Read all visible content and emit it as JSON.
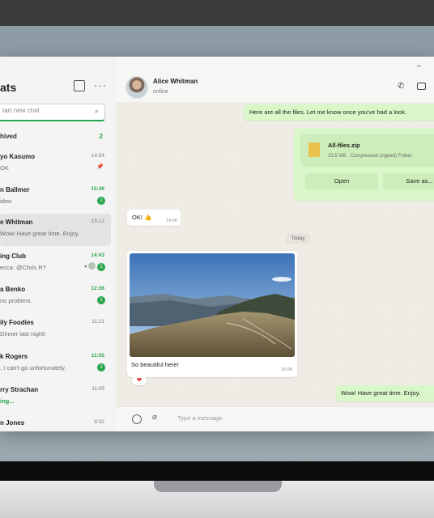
{
  "sidebar": {
    "title": "ats",
    "search_placeholder": "tart new chat",
    "archived_label": "hived",
    "archived_count": "2",
    "chats": [
      {
        "name": "yo Kasumo",
        "preview": "OK",
        "time": "14:54",
        "pinned": true
      },
      {
        "name": "n Ballmer",
        "preview": "ideo",
        "time": "15:36",
        "unread": "1"
      },
      {
        "name": "e Whitman",
        "preview": "Wow! Have great time. Enjoy.",
        "time": "15:12"
      },
      {
        "name": "ing Club",
        "preview": "ecca: @Chris R?",
        "time": "14:43",
        "unread": "1"
      },
      {
        "name": "a Benko",
        "preview": "no problem.",
        "time": "12:36",
        "unread": "1"
      },
      {
        "name": "ily Foodies",
        "preview": "Dinner last night!",
        "time": "11:21"
      },
      {
        "name": "k Rogers",
        "preview": ", I can't go unfortunately.",
        "time": "11:05",
        "unread": "1"
      },
      {
        "name": "rry Strachan",
        "preview": "ing...",
        "time": "11:05"
      },
      {
        "name": "n Jones",
        "preview": "",
        "time": "8:32"
      }
    ]
  },
  "chat": {
    "contact_name": "Alice Whitman",
    "contact_status": "online",
    "messages": {
      "out_1": "Here are all the files. Let me know once you've had a look.",
      "file_name": "All-files.zip",
      "file_meta": "23.5 MB · Compressed (zipped) Folder",
      "open_label": "Open",
      "save_label": "Save as...",
      "in_1": "OK! 👍",
      "in_1_time": "14:06",
      "day_separator": "Today",
      "photo_caption": "So beautiful here!",
      "photo_time": "15:06",
      "reaction": "❤",
      "out_2": "Wow! Have great time. Enjoy."
    },
    "composer_placeholder": "Type a message"
  },
  "colors": {
    "accent_green": "#2aa64f",
    "outgoing_bubble": "#d9f7c8",
    "incoming_bubble": "#ffffff"
  }
}
